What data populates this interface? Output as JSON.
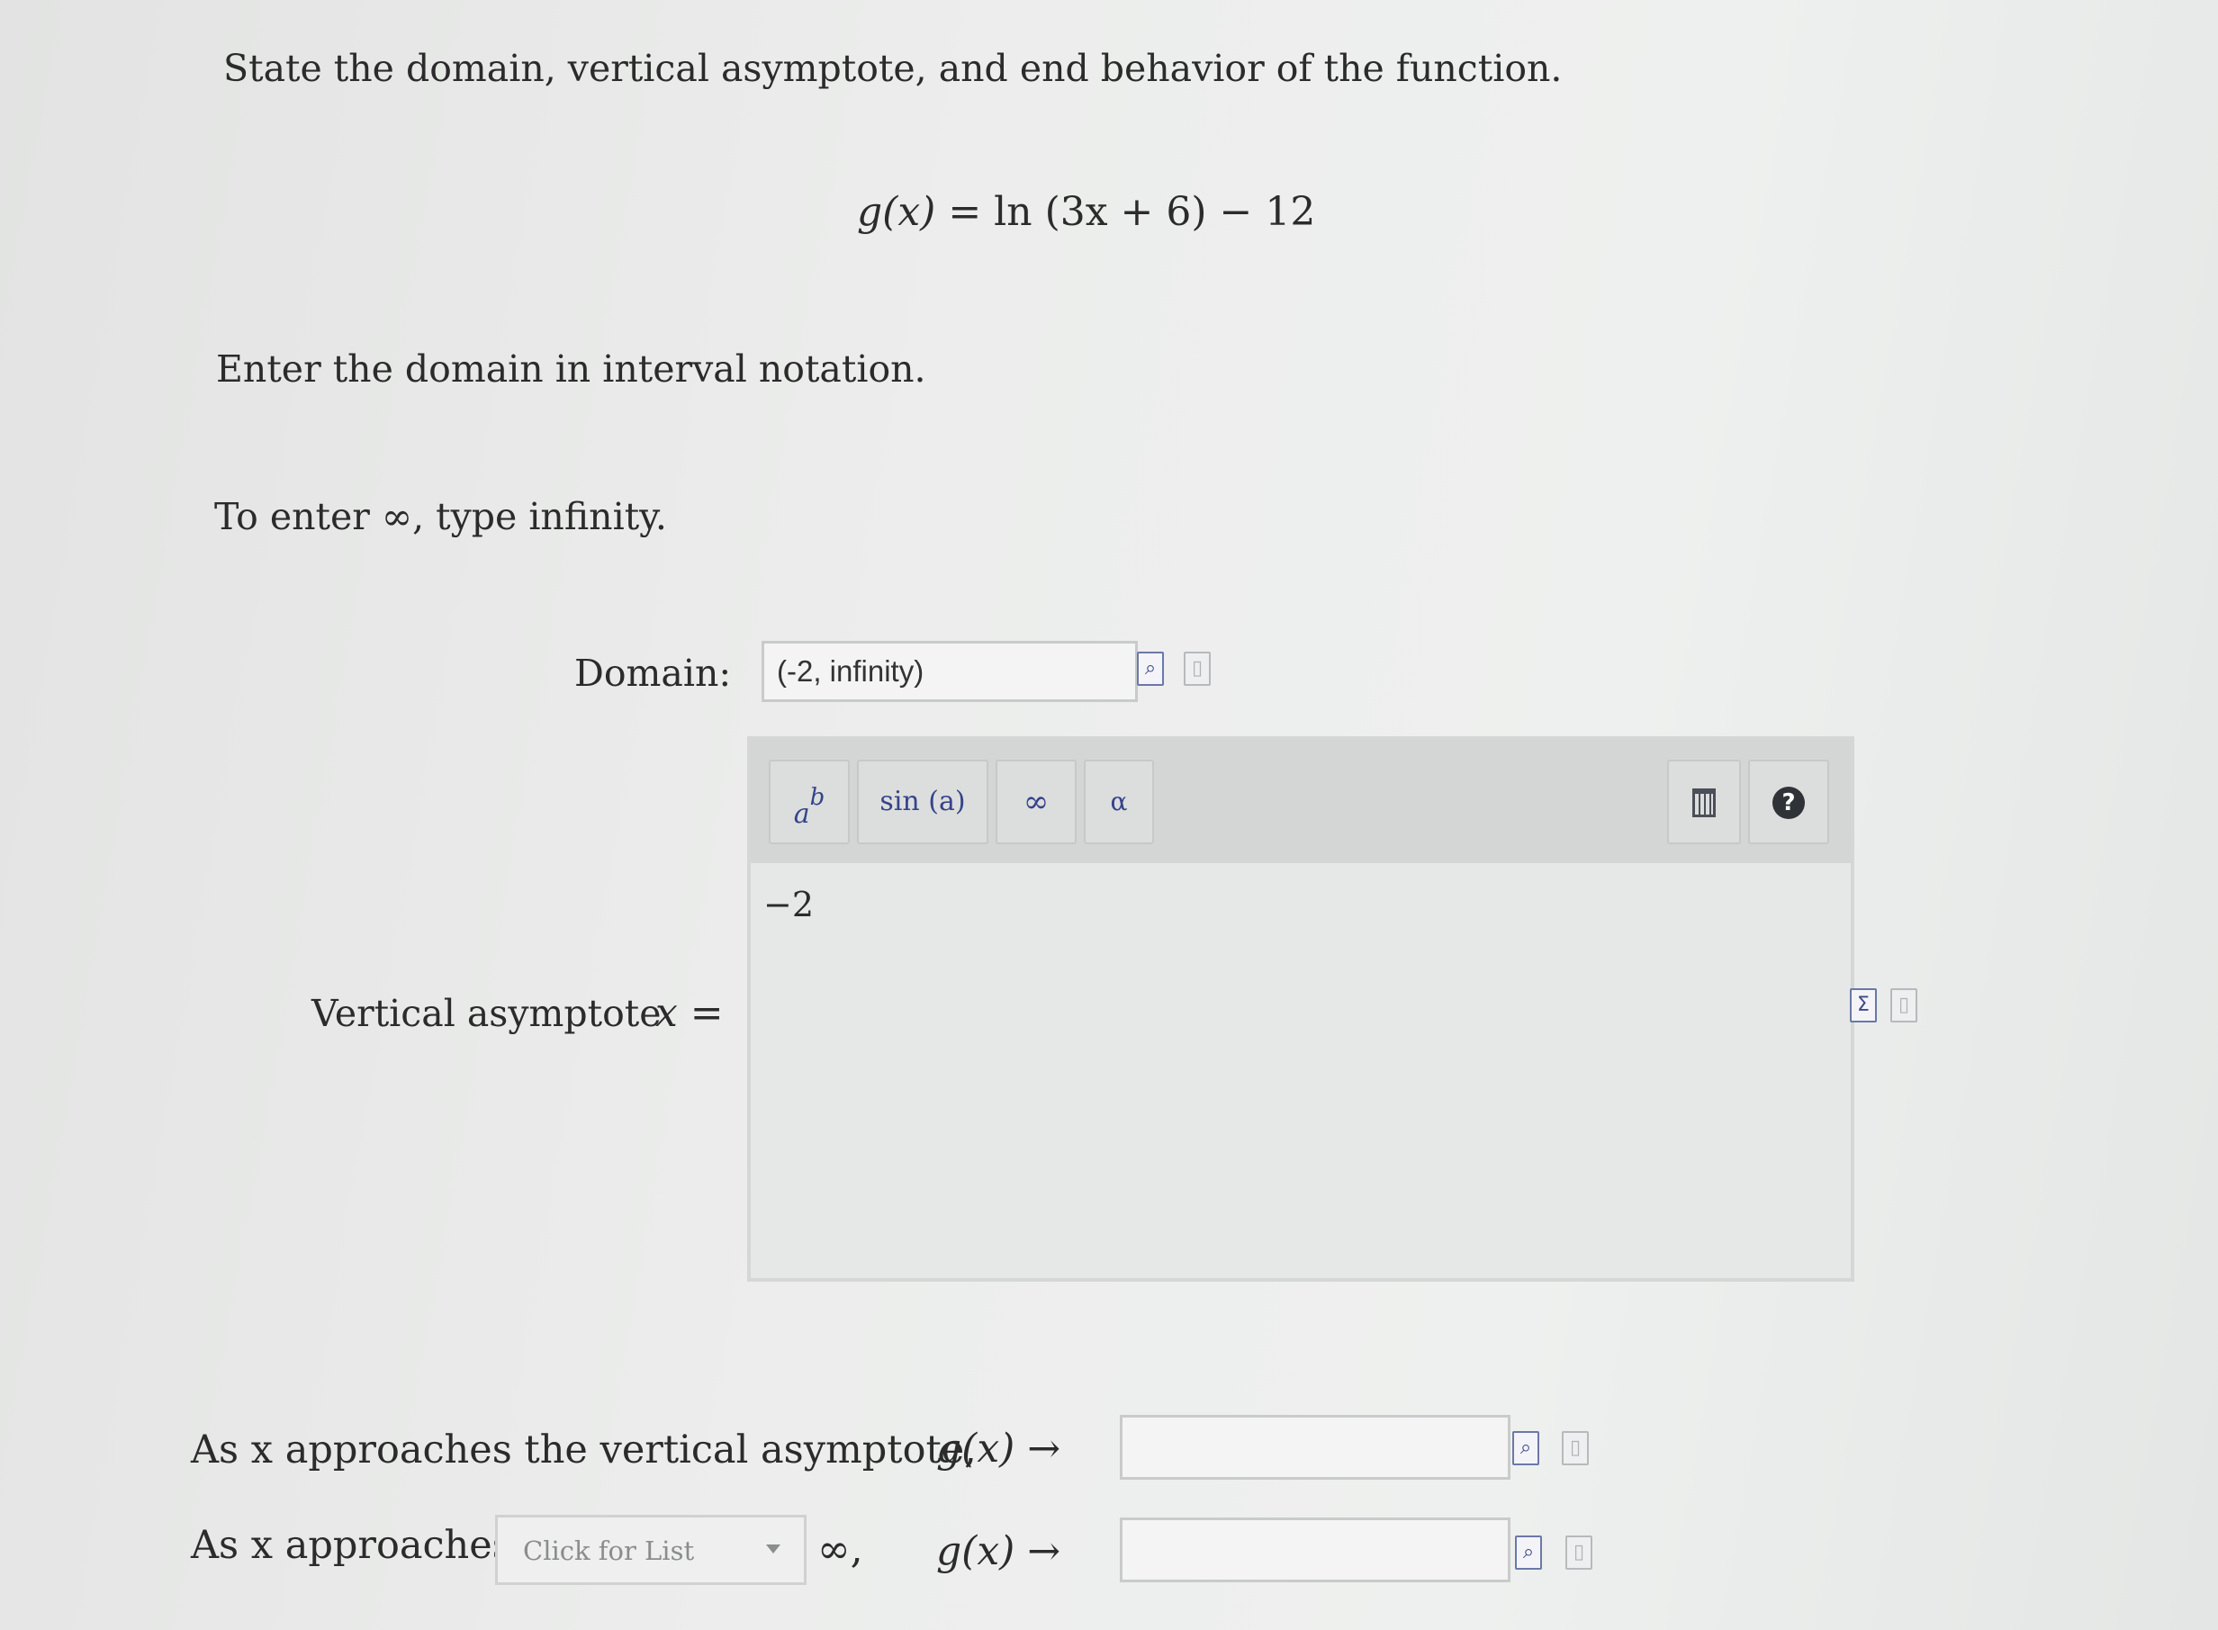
{
  "question": {
    "instruction": "State the domain, vertical asymptote, and end behavior of the function.",
    "function_lhs": "g(x)",
    "function_rhs": "= ln (3x + 6) − 12",
    "domain_instruction": "Enter the domain in interval notation.",
    "infinity_hint": "To enter ∞, type infinity."
  },
  "domain": {
    "label": "Domain:",
    "value": "(-2, infinity)"
  },
  "asymptote": {
    "label": "Vertical asymptote",
    "variable": "x =",
    "value": "−2"
  },
  "editor_toolbar": {
    "power_base": "a",
    "power_exp": "b",
    "sin_label": "sin (a)",
    "infinity_label": "∞",
    "alpha_label": "α",
    "help_label": "?"
  },
  "end_behavior": {
    "row1_prefix": "As x approaches the vertical asymptote,",
    "row1_gx": "g(x) →",
    "row1_value": "",
    "row2_prefix": "As x approaches",
    "row2_select_placeholder": "Click for List",
    "row2_infinity": "∞,",
    "row2_gx": "g(x) →",
    "row2_value": ""
  },
  "icons": {
    "preview": "preview-icon",
    "sigma": "sigma-icon",
    "document": "document-icon",
    "trash": "trash-icon",
    "help": "help-icon",
    "dropdown": "chevron-down-icon"
  }
}
